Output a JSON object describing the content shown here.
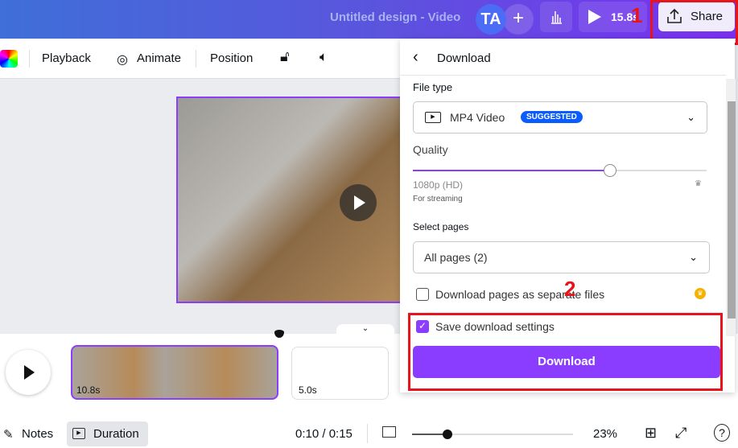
{
  "header": {
    "title": "Untitled design - Video",
    "avatar": "TA",
    "add": "+",
    "duration": "15.8s",
    "share": "Share"
  },
  "annotations": {
    "step1": "1",
    "step2": "2"
  },
  "toolbar": {
    "playback": "Playback",
    "animate": "Animate",
    "position": "Position"
  },
  "download_panel": {
    "title": "Download",
    "file_type_label": "File type",
    "file_type_value": "MP4 Video",
    "suggested_badge": "SUGGESTED",
    "quality_label": "Quality",
    "quality_value": "1080p (HD)",
    "quality_level": 0.67,
    "quality_hint": "For streaming",
    "select_pages_label": "Select pages",
    "select_pages_value": "All pages (2)",
    "separate_files_label": "Download pages as separate files",
    "separate_files_checked": false,
    "save_settings_label": "Save download settings",
    "save_settings_checked": true,
    "download_button": "Download"
  },
  "timeline": {
    "clips": [
      {
        "duration": "10.8s"
      },
      {
        "duration": "5.0s"
      }
    ]
  },
  "bottom": {
    "notes": "Notes",
    "duration": "Duration",
    "time": "0:10 / 0:15",
    "zoom": "23%",
    "zoom_level": 0.23
  },
  "colors": {
    "accent": "#8b3dff",
    "badge": "#0b5cff",
    "annotation": "#e8141c"
  }
}
